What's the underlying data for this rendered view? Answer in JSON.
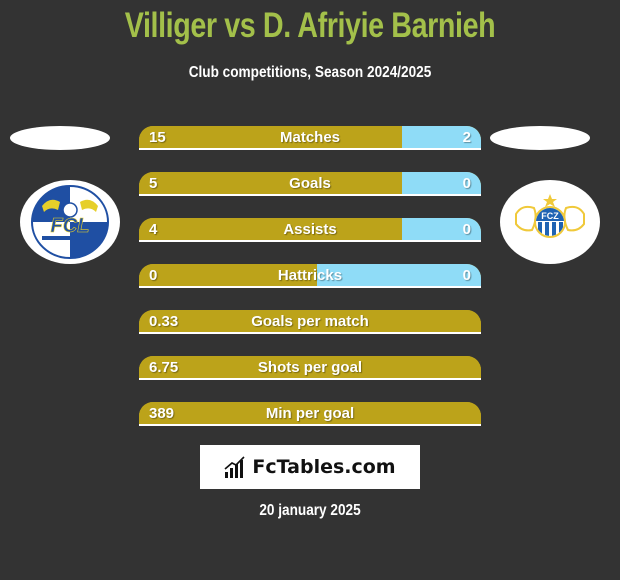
{
  "header": {
    "title": "Villiger vs D. Afriyie Barnieh",
    "subtitle": "Club competitions, Season 2024/2025"
  },
  "players": {
    "left": {
      "name": "Villiger",
      "club_logo": "fc-luzern-logo",
      "club_logo_text": "FCL"
    },
    "right": {
      "name": "D. Afriyie Barnieh",
      "club_logo": "fc-zurich-logo",
      "club_logo_text": "FCZ"
    }
  },
  "colors": {
    "title": "#a3c04a",
    "left_bar": "#bca31a",
    "right_bar": "#8fdcf7",
    "background": "#333333"
  },
  "stats": [
    {
      "label": "Matches",
      "left": "15",
      "right": "2",
      "left_share": 0.77
    },
    {
      "label": "Goals",
      "left": "5",
      "right": "0",
      "left_share": 0.77
    },
    {
      "label": "Assists",
      "left": "4",
      "right": "0",
      "left_share": 0.77
    },
    {
      "label": "Hattricks",
      "left": "0",
      "right": "0",
      "left_share": 0.52
    },
    {
      "label": "Goals per match",
      "left": "0.33",
      "right": "",
      "left_share": 1.0
    },
    {
      "label": "Shots per goal",
      "left": "6.75",
      "right": "",
      "left_share": 1.0
    },
    {
      "label": "Min per goal",
      "left": "389",
      "right": "",
      "left_share": 1.0
    }
  ],
  "brand": {
    "name": "FcTables.com",
    "icon": "bar-chart-icon"
  },
  "footer": {
    "date": "20 january 2025"
  }
}
